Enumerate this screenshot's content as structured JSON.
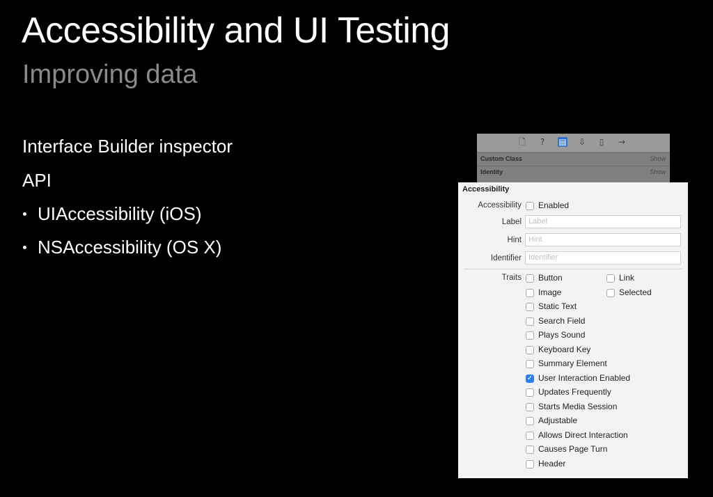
{
  "slide": {
    "title": "Accessibility and UI Testing",
    "subtitle": "Improving data",
    "lines": [
      "Interface Builder inspector",
      "API",
      "UIAccessibility (iOS)",
      "NSAccessibility (OS X)"
    ]
  },
  "inspector": {
    "toolbar_icons": [
      "file-icon",
      "help-icon",
      "identity-icon",
      "attributes-icon",
      "size-icon",
      "connections-icon"
    ],
    "sections": [
      {
        "label": "Custom Class",
        "action": "Show"
      },
      {
        "label": "Identity",
        "action": "Show"
      }
    ],
    "panel_title": "Accessibility",
    "accessibility_label": "Accessibility",
    "enabled_label": "Enabled",
    "fields": [
      {
        "label": "Label",
        "placeholder": "Label"
      },
      {
        "label": "Hint",
        "placeholder": "Hint"
      },
      {
        "label": "Identifier",
        "placeholder": "Identifier"
      }
    ],
    "traits_label": "Traits",
    "traits_col1": [
      {
        "label": "Button",
        "checked": false
      },
      {
        "label": "Image",
        "checked": false
      },
      {
        "label": "Static Text",
        "checked": false
      },
      {
        "label": "Search Field",
        "checked": false
      },
      {
        "label": "Plays Sound",
        "checked": false
      },
      {
        "label": "Keyboard Key",
        "checked": false
      },
      {
        "label": "Summary Element",
        "checked": false
      },
      {
        "label": "User Interaction Enabled",
        "checked": true
      },
      {
        "label": "Updates Frequently",
        "checked": false
      },
      {
        "label": "Starts Media Session",
        "checked": false
      },
      {
        "label": "Adjustable",
        "checked": false
      },
      {
        "label": "Allows Direct Interaction",
        "checked": false
      },
      {
        "label": "Causes Page Turn",
        "checked": false
      },
      {
        "label": "Header",
        "checked": false
      }
    ],
    "traits_col2": [
      {
        "label": "Link",
        "checked": false
      },
      {
        "label": "Selected",
        "checked": false
      }
    ]
  }
}
